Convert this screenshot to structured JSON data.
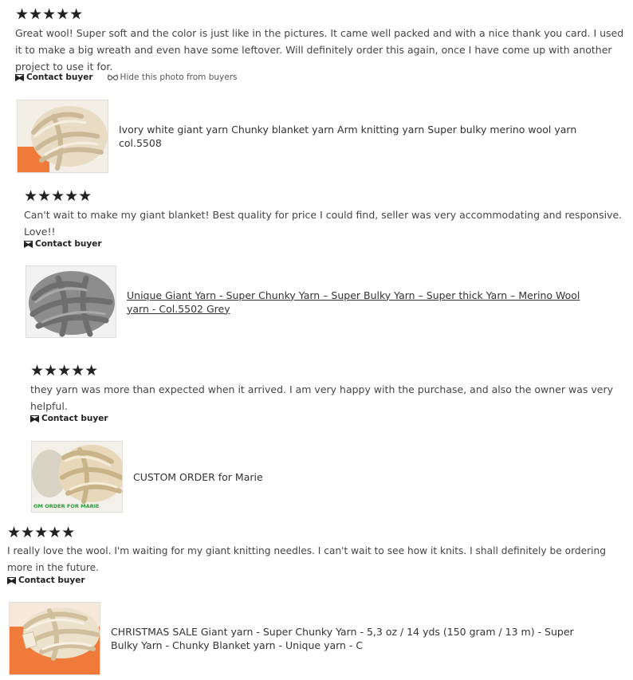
{
  "reviews": [
    {
      "rating": "★★★★★",
      "text": "Great wool! Super soft and the color is just like in the pictures. It came well packed and with a nice thank you card. I used it to make a big wreath and even have some leftover. Will definitely order this again, once I have come up with another project to use it for.",
      "contact_label": "Contact buyer",
      "hide_photo_label": "Hide this photo from buyers",
      "product_title_line1": "Ivory white giant yarn Chunky blanket yarn Arm knitting yarn Super bulky merino wool yarn",
      "product_title_line2": "col.5508"
    },
    {
      "rating": "★★★★★",
      "text": "Can't wait to make my giant blanket! Best quality for price I could find, seller was very accommodating and responsive. Love!!",
      "contact_label": "Contact buyer",
      "product_title_line1": "Unique Giant Yarn - Super Chunky Yarn – Super Bulky Yarn – Super thick Yarn – Merino Wool",
      "product_title_line2": "yarn - Col.5502 Grey"
    },
    {
      "rating": "★★★★★",
      "text": "they yarn was more than expected when it arrived. I am very happy with the purchase, and also the owner was very helpful.",
      "contact_label": "Contact buyer",
      "product_title_line1": "CUSTOM ORDER for Marie",
      "thumb_caption": "OM ORDER FOR MARIE"
    },
    {
      "rating": "★★★★★",
      "text": "I really love the wool. I'm waiting for my giant knitting needles. I can't wait to see how it knits. I shall definitely be ordering more in the future.",
      "contact_label": "Contact buyer",
      "product_title_line1": "CHRISTMAS SALE Giant yarn - Super Chunky Yarn - 5,3 oz / 14 yds (150 gram / 13 m) - Super",
      "product_title_line2": "Bulky Yarn - Chunky Blanket yarn - Unique yarn - C"
    }
  ],
  "icons": {
    "envelope": "envelope-icon",
    "glasses": "hide-eye-icon"
  },
  "colors": {
    "caption_green": "#2a9d3a",
    "thumb_orange": "#f07a3a"
  }
}
